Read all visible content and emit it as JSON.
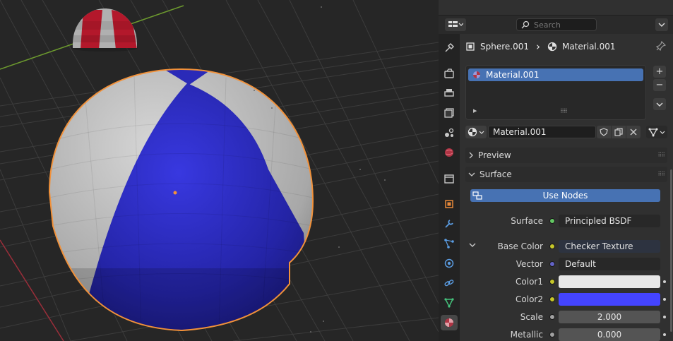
{
  "topbar": {
    "search_placeholder": "Search",
    "editor_type_icon": "properties-editor-icon"
  },
  "breadcrumb": {
    "object": "Sphere.001",
    "separator": "›",
    "material": "Material.001"
  },
  "material_slots": {
    "items": [
      {
        "label": "Material.001",
        "selected": true
      }
    ],
    "add_label": "+",
    "remove_label": "−"
  },
  "material_datablock": {
    "name": "Material.001"
  },
  "panels": {
    "preview": "Preview",
    "surface": "Surface"
  },
  "use_nodes_label": "Use Nodes",
  "properties": [
    {
      "label": "Surface",
      "value": "Principled BSDF",
      "socket_color": "#63c763",
      "kind": "link"
    },
    {
      "label": "Base Color",
      "value": "Checker Texture",
      "socket_color": "#c7c729",
      "kind": "link-expanded"
    },
    {
      "label": "Vector",
      "value": "Default",
      "socket_color": "#6363c7",
      "kind": "link"
    },
    {
      "label": "Color1",
      "value": "",
      "socket_color": "#c7c729",
      "kind": "color",
      "color": "#e8e8e8"
    },
    {
      "label": "Color2",
      "value": "",
      "socket_color": "#c7c729",
      "kind": "color",
      "color": "#4444ff"
    },
    {
      "label": "Scale",
      "value": "2.000",
      "socket_color": "#a1a1a1",
      "kind": "number"
    },
    {
      "label": "Metallic",
      "value": "0.000",
      "socket_color": "#a1a1a1",
      "kind": "number"
    }
  ],
  "colors": {
    "accent": "#4772b3",
    "selection_outline": "#f1913a",
    "sphere_blue": "#2a2ab0",
    "sphere_white": "#c8c8c8",
    "background_sphere_red": "#b3182b"
  },
  "tabs": [
    "tool-icon",
    "render-icon",
    "output-icon",
    "view-layer-icon",
    "scene-icon",
    "world-icon",
    "collection-icon",
    "object-icon",
    "modifier-icon",
    "particles-icon",
    "physics-icon",
    "constraints-icon",
    "object-data-icon",
    "material-icon"
  ]
}
